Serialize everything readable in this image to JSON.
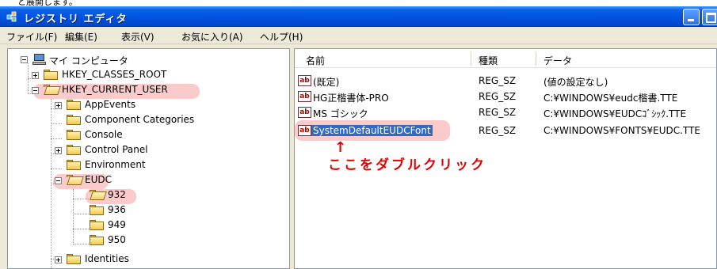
{
  "caption_fragment": "と展開します。",
  "window": {
    "title": "レジストリ エディタ"
  },
  "menu": [
    "ファイル(F)",
    "編集(E)",
    "表示(V)",
    "お気に入り(A)",
    "ヘルプ(H)"
  ],
  "tree": {
    "root": "マイ コンピュータ",
    "classes_root": "HKEY_CLASSES_ROOT",
    "current_user": "HKEY_CURRENT_USER",
    "children": [
      "AppEvents",
      "Component Categories",
      "Console",
      "Control Panel",
      "Environment",
      "EUDC",
      "Identities"
    ],
    "eudc_children": [
      "932",
      "936",
      "949",
      "950"
    ]
  },
  "list": {
    "headers": [
      "名前",
      "種類",
      "データ"
    ],
    "rows": [
      {
        "name": "(既定)",
        "type": "REG_SZ",
        "data": "(値の設定なし)"
      },
      {
        "name": "HG正楷書体-PRO",
        "type": "REG_SZ",
        "data": "C:¥WINDOWS¥eudc楷書.TTE"
      },
      {
        "name": "MS ゴシック",
        "type": "REG_SZ",
        "data": "C:¥WINDOWS¥EUDCｺﾞｼｯｸ.TTE"
      },
      {
        "name": "SystemDefaultEUDCFont",
        "type": "REG_SZ",
        "data": "C:¥WINDOWS¥FONTS¥EUDC.TTE"
      }
    ],
    "value_icon_text": "ab"
  },
  "annotation": {
    "arrow": "↑",
    "text": "ここをダブルクリック"
  },
  "colors": {
    "titlebar": "#0054e3",
    "highlight": "#f8a0a0",
    "annotation": "#e00000",
    "selection": "#316ac5"
  }
}
